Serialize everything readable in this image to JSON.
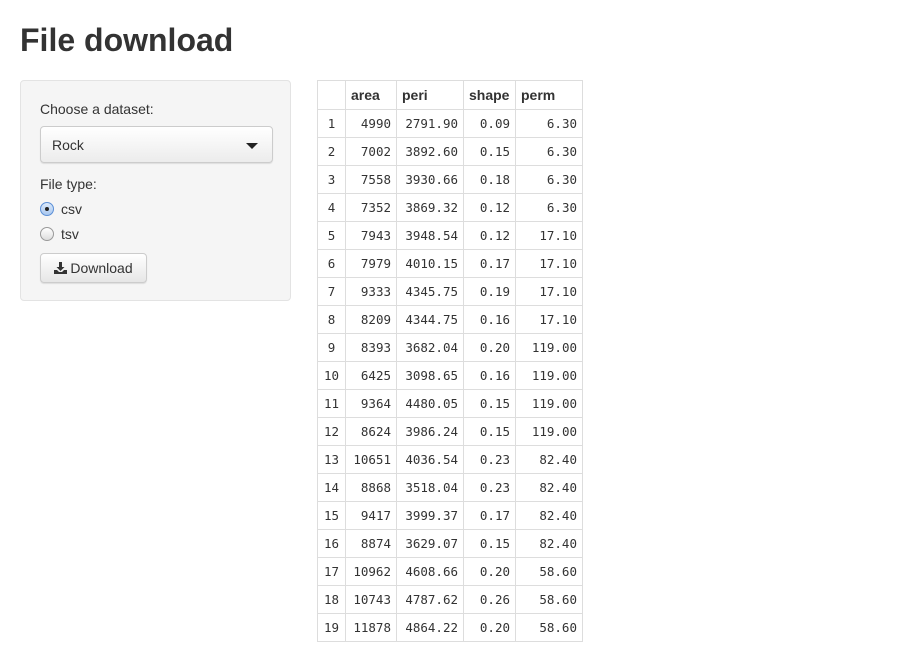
{
  "title": "File download",
  "sidebar": {
    "dataset_label": "Choose a dataset:",
    "dataset_value": "Rock",
    "filetype_label": "File type:",
    "filetypes": [
      {
        "label": "csv",
        "selected": true
      },
      {
        "label": "tsv",
        "selected": false
      }
    ],
    "download_label": "Download",
    "download_icon": "download-icon"
  },
  "table": {
    "columns": [
      "",
      "area",
      "peri",
      "shape",
      "perm"
    ],
    "rows": [
      [
        "1",
        "4990",
        "2791.90",
        "0.09",
        "6.30"
      ],
      [
        "2",
        "7002",
        "3892.60",
        "0.15",
        "6.30"
      ],
      [
        "3",
        "7558",
        "3930.66",
        "0.18",
        "6.30"
      ],
      [
        "4",
        "7352",
        "3869.32",
        "0.12",
        "6.30"
      ],
      [
        "5",
        "7943",
        "3948.54",
        "0.12",
        "17.10"
      ],
      [
        "6",
        "7979",
        "4010.15",
        "0.17",
        "17.10"
      ],
      [
        "7",
        "9333",
        "4345.75",
        "0.19",
        "17.10"
      ],
      [
        "8",
        "8209",
        "4344.75",
        "0.16",
        "17.10"
      ],
      [
        "9",
        "8393",
        "3682.04",
        "0.20",
        "119.00"
      ],
      [
        "10",
        "6425",
        "3098.65",
        "0.16",
        "119.00"
      ],
      [
        "11",
        "9364",
        "4480.05",
        "0.15",
        "119.00"
      ],
      [
        "12",
        "8624",
        "3986.24",
        "0.15",
        "119.00"
      ],
      [
        "13",
        "10651",
        "4036.54",
        "0.23",
        "82.40"
      ],
      [
        "14",
        "8868",
        "3518.04",
        "0.23",
        "82.40"
      ],
      [
        "15",
        "9417",
        "3999.37",
        "0.17",
        "82.40"
      ],
      [
        "16",
        "8874",
        "3629.07",
        "0.15",
        "82.40"
      ],
      [
        "17",
        "10962",
        "4608.66",
        "0.20",
        "58.60"
      ],
      [
        "18",
        "10743",
        "4787.62",
        "0.26",
        "58.60"
      ],
      [
        "19",
        "11878",
        "4864.22",
        "0.20",
        "58.60"
      ]
    ]
  }
}
